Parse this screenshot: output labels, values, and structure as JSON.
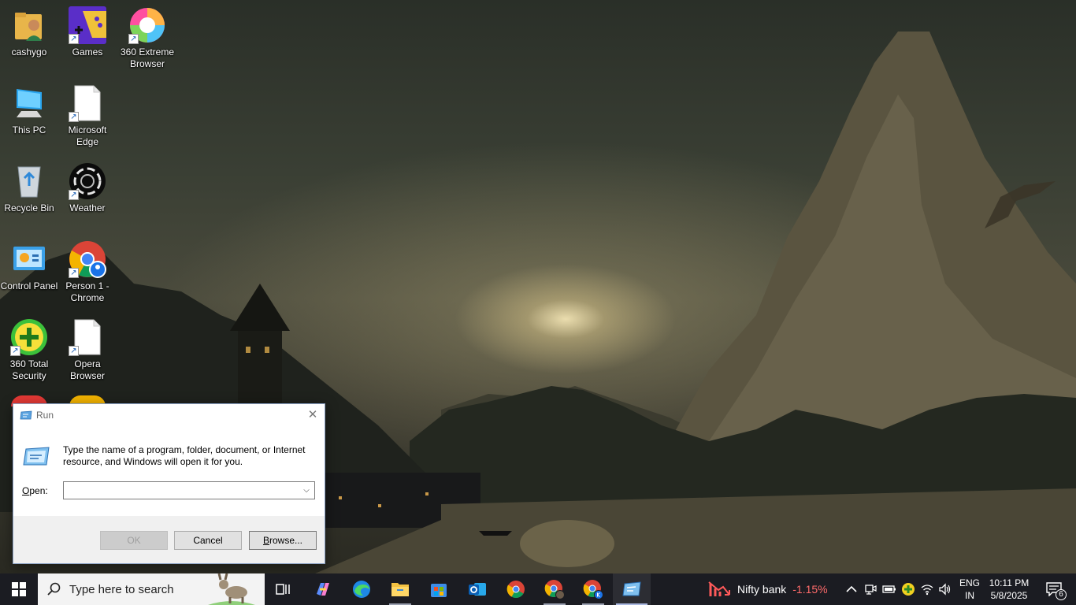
{
  "desktop": {
    "icons": [
      {
        "label": "cashygo"
      },
      {
        "label": "Games"
      },
      {
        "label": "360 Extreme Browser"
      },
      {
        "label": "This PC"
      },
      {
        "label": "Microsoft Edge"
      },
      {
        "label": "Recycle Bin"
      },
      {
        "label": "Weather"
      },
      {
        "label": "Control Panel"
      },
      {
        "label": "Person 1 - Chrome"
      },
      {
        "label": "360 Total Security"
      },
      {
        "label": "Opera Browser"
      }
    ]
  },
  "run_dialog": {
    "title": "Run",
    "close_glyph": "✕",
    "description": "Type the name of a program, folder, document, or Internet resource, and Windows will open it for you.",
    "open_label_accel": "O",
    "open_label_rest": "pen:",
    "open_value": "",
    "ok_label": "OK",
    "cancel_label": "Cancel",
    "browse_label_accel": "B",
    "browse_label_rest": "rowse..."
  },
  "taskbar": {
    "search_placeholder": "Type here to search",
    "widget": {
      "name": "Nifty bank",
      "change": "-1.15%"
    },
    "lang_line1": "ENG",
    "lang_line2": "IN",
    "time": "10:11 PM",
    "date": "5/8/2025",
    "notification_count": "6"
  },
  "colors": {
    "taskbar_bg": "#1b1c22",
    "accent": "#0078d4",
    "stock_down": "#ff6b6b"
  }
}
